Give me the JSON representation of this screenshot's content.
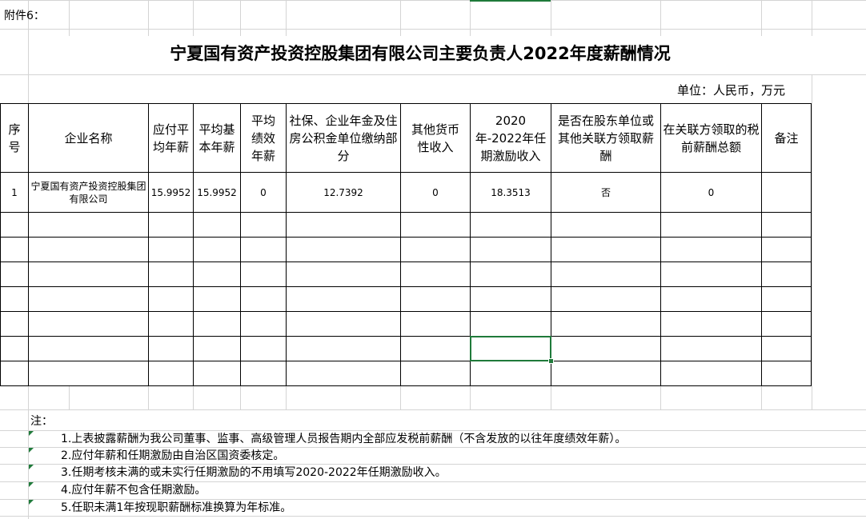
{
  "attachment_label": "附件6：",
  "title": "宁夏国有资产投资控股集团有限公司主要负责人2022年度薪酬情况",
  "unit": "单位：人民币，万元",
  "headers": {
    "seq": "序号",
    "company": "企业名称",
    "annual_salary": "应付平均年薪",
    "base_salary": "平均基本年薪",
    "performance_salary": "平均绩效年薪",
    "social_insurance": "社保、企业年金及住房公积金单位缴纳部分",
    "other_income": "其他货币性收入",
    "incentive": "2020年-2022年任期激励收入",
    "shareholder_pay": "是否在股东单位或其他关联方领取薪酬",
    "related_pay": "在关联方领取的税前薪酬总额",
    "remark": "备注"
  },
  "rows": [
    {
      "seq": "1",
      "company": "宁夏国有资产投资控股集团有限公司",
      "annual_salary": "15.9952",
      "base_salary": "15.9952",
      "performance_salary": "0",
      "social_insurance": "12.7392",
      "other_income": "0",
      "incentive": "18.3513",
      "shareholder_pay": "否",
      "related_pay": "0",
      "remark": ""
    }
  ],
  "notes": {
    "label": "注：",
    "items": [
      "1.上表披露薪酬为我公司董事、监事、高级管理人员报告期内全部应发税前薪酬（不含发放的以往年度绩效年薪）。",
      "2.应付年薪和任期激励由自治区国资委核定。",
      "3.任期考核未满的或未实行任期激励的不用填写2020-2022年任期激励收入。",
      "4.应付年薪不包含任期激励。",
      "5.任职未满1年按现职薪酬标准换算为年标准。"
    ]
  },
  "colors": {
    "gridline": "#d4d4d4",
    "border": "#000000",
    "selection": "#1f7a3a"
  }
}
